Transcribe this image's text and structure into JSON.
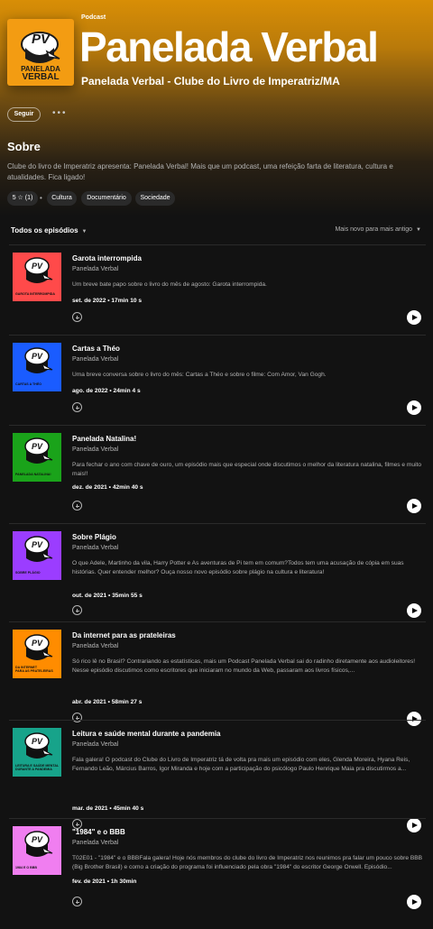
{
  "show": {
    "type_label": "Podcast",
    "title": "Panelada Verbal",
    "subtitle": "Panelada Verbal - Clube do Livro de Imperatriz/MA",
    "cover_logo_text": "PV",
    "cover_name_line1": "PANELADA",
    "cover_name_line2": "VERBAL",
    "follow_label": "Seguir",
    "more_label": "•••"
  },
  "about": {
    "heading": "Sobre",
    "text": "Clube do livro de Imperatriz apresenta: Panelada Verbal! Mais que um podcast, uma refeição farta de literatura, cultura e atualidades. Fica ligado!",
    "rating_label": "5 ☆ (1)",
    "separator": "•",
    "categories": [
      "Cultura",
      "Documentário",
      "Sociedade"
    ]
  },
  "episodes_header": {
    "title": "Todos os episódios",
    "sort_label": "Mais novo para mais antigo"
  },
  "colors": {
    "hero_accent": "#d88e06",
    "background": "#121212"
  },
  "episodes": [
    {
      "title": "Garota interrompida",
      "show": "Panelada Verbal",
      "description": "Um breve bate papo sobre o livro do mês de agosto: Garota interrompida.",
      "meta": "set. de 2022 • 17min 10 s",
      "art_label": "Garota Interrompida",
      "art_color": "#ff4a4a",
      "art_logo": "PV"
    },
    {
      "title": "Cartas a Théo",
      "show": "Panelada Verbal",
      "description": "Uma breve conversa sobre o livro do mês: Cartas a Théo e sobre o filme: Com Amor, Van Gogh.",
      "meta": "ago. de 2022 • 24min 4 s",
      "art_label": "Cartas a Théo",
      "art_color": "#1a5cff",
      "art_logo": "PV"
    },
    {
      "title": "Panelada Natalina!",
      "show": "Panelada Verbal",
      "description": "Para fechar o ano com chave de ouro, um episódio mais que especial onde discutimos o melhor da literatura natalina, filmes e muito mais!!",
      "meta": "dez. de 2021 • 42min 40 s",
      "art_label": "Panelada natalina!",
      "art_color": "#1aa31a",
      "art_logo": "PV"
    },
    {
      "title": "Sobre Plágio",
      "show": "Panelada Verbal",
      "description": "O que Adele, Martinho da vila, Harry Potter e As aventuras de Pi tem em comum?Todos tem uma acusação de cópia em suas histórias. Quer entender melhor? Ouça nosso novo episódio sobre plágio na cultura e literatura!",
      "meta": "out. de 2021 • 35min 55 s",
      "art_label": "Sobre plágio",
      "art_color": "#9b3dff",
      "art_logo": "PV"
    },
    {
      "title": "Da internet para as prateleiras",
      "show": "Panelada Verbal",
      "description": "Só rico lê no Brasil? Contrariando as estatísticas, mais um Podcast Panelada Verbal sai do radinho diretamente aos audioleitores! Nesse episódio discutimos como escritores que iniciaram no mundo da Web, passaram aos livros físicos,...",
      "meta": "abr. de 2021 • 58min 27 s",
      "art_label": "Da internet\npara as prateleiras",
      "art_color": "#ff8c00",
      "art_logo": "PV"
    },
    {
      "title": "Leitura e saúde mental durante a pandemia",
      "show": "Panelada Verbal",
      "description": "Fala galera! O podcast do Clube do Livro de Imperatriz tá de volta pra mais um episódio com eles, Glenda Moreira, Hyana Reis, Fernando Leão, Március Barros, Igor Miranda e hoje com a participação do psicólogo Paulo Henrique Maia pra discutirmos a...",
      "meta": "mar. de 2021 • 45min 40 s",
      "art_label": "Leitura e saúde mental\ndurante a pandemia",
      "art_color": "#17a38a",
      "art_logo": "PV"
    },
    {
      "title": "\"1984\" e o BBB",
      "show": "Panelada Verbal",
      "description": "T02E01 - \"1984\" e o BBBFala galera! Hoje nós membros do clube do livro de Imperatriz nos reunimos pra falar um pouco sobre BBB (Big Brother Brasil) e como a criação do programa foi influenciado pela obra \"1984\" do escritor George Orwell. Episódio...",
      "meta": "fev. de 2021 • 1h 30min",
      "art_label": "1984 e o BBB",
      "art_color": "#f07ef0",
      "art_logo": "PV"
    }
  ]
}
